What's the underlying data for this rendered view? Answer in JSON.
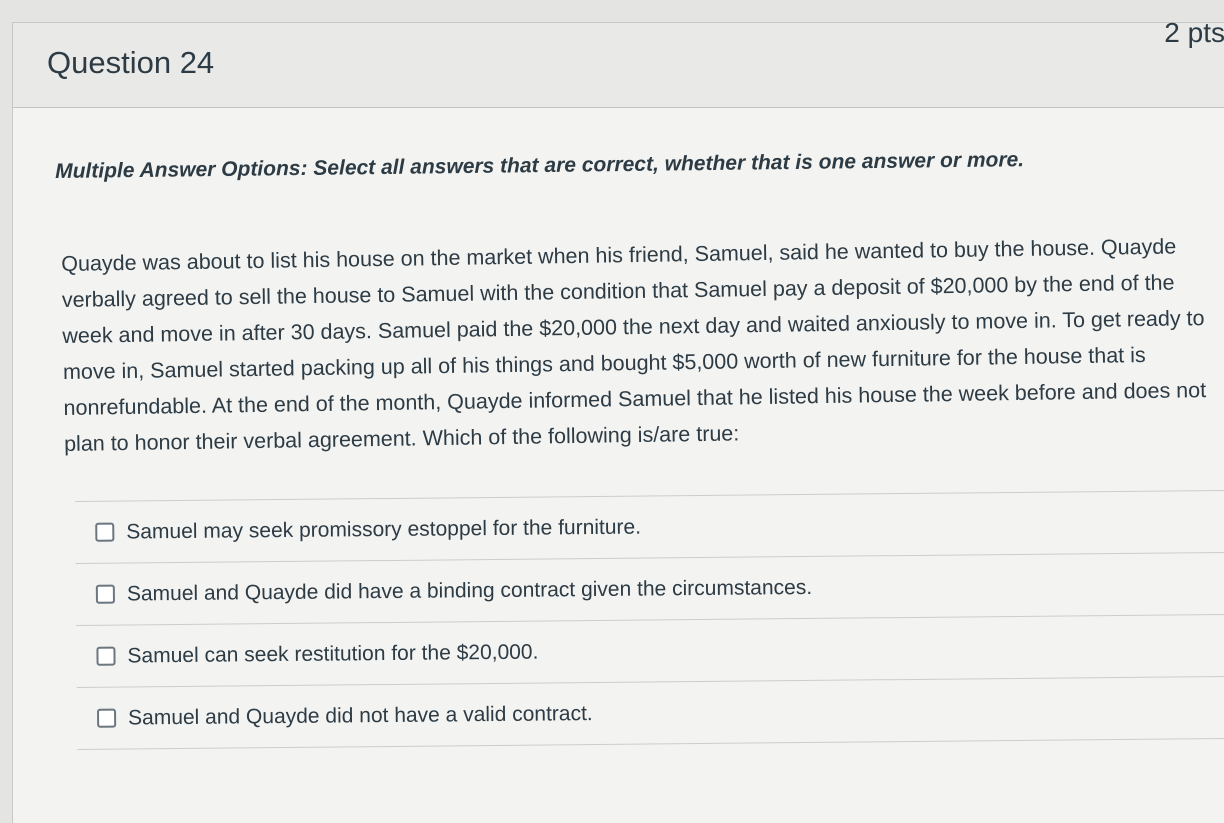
{
  "question": {
    "title": "Question 24",
    "points": "2 pts"
  },
  "instructions": "Multiple Answer Options: Select all answers that are correct, whether that is one answer or more.",
  "question_text": "Quayde was about to list his house on the market when his friend, Samuel, said he wanted to buy the house. Quayde verbally agreed to sell the house to Samuel with the condition that Samuel pay a deposit of $20,000 by the end of the week and move in after 30 days. Samuel paid the $20,000 the next day and waited anxiously to move in. To get ready to move in, Samuel started packing up all of his things and bought $5,000 worth of new furniture for the house that is nonrefundable. At the end of the month, Quayde informed Samuel that he listed his house the week before and does not plan to honor their verbal agreement. Which of the following is/are true:",
  "answers": [
    {
      "label": "Samuel may seek promissory estoppel for the furniture.",
      "checked": false
    },
    {
      "label": "Samuel and Quayde did have a binding contract given the circumstances.",
      "checked": false
    },
    {
      "label": "Samuel can seek restitution for the $20,000.",
      "checked": false
    },
    {
      "label": "Samuel and Quayde did not have a valid contract.",
      "checked": false
    }
  ]
}
